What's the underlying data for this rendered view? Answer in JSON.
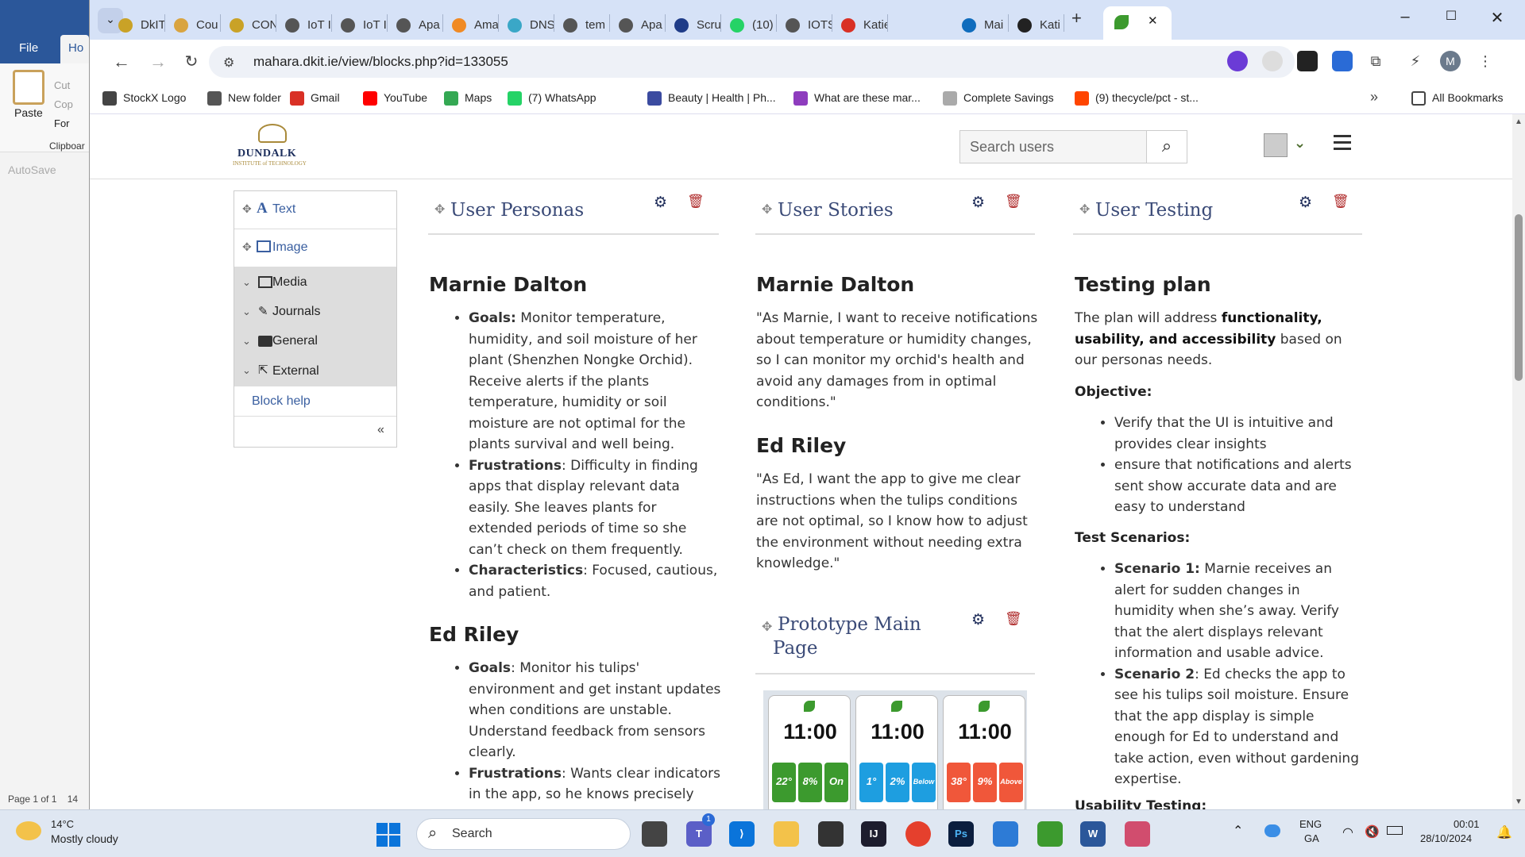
{
  "word": {
    "file_tab": "File",
    "home_tab": "Ho",
    "paste_label": "Paste",
    "cut_label": "Cut",
    "copy_label": "Cop",
    "format_label": "For",
    "clipboard_label": "Clipboar",
    "autosave_label": "AutoSave",
    "status_page": "Page 1 of 1",
    "status_words": "14"
  },
  "browser": {
    "tabs": [
      {
        "label": "DkIT",
        "color": "#c9a227"
      },
      {
        "label": "Cou",
        "color": "#d9a440"
      },
      {
        "label": "CON",
        "color": "#c9a227"
      },
      {
        "label": "IoT I",
        "color": "#555"
      },
      {
        "label": "IoT I",
        "color": "#555"
      },
      {
        "label": "Apa",
        "color": "#555"
      },
      {
        "label": "Ama",
        "color": "#f08a24"
      },
      {
        "label": "DNS",
        "color": "#3aa7c7"
      },
      {
        "label": "tem",
        "color": "#555"
      },
      {
        "label": "Apa",
        "color": "#555"
      },
      {
        "label": "Scru",
        "color": "#1f3c88"
      },
      {
        "label": "(10)",
        "color": "#25d366"
      },
      {
        "label": "IOTS",
        "color": "#555"
      },
      {
        "label": "Katie",
        "color": "#d93025"
      },
      {
        "label": "",
        "color": "#3c9a2e"
      },
      {
        "label": "Mai",
        "color": "#0f6cbd"
      },
      {
        "label": "Kati",
        "color": "#222"
      }
    ],
    "close_tab_glyph": "✕",
    "new_tab_glyph": "+",
    "url": "mahara.dkit.ie/view/blocks.php?id=133055",
    "profile_initial": "M",
    "bookmarks": [
      {
        "label": "StockX Logo",
        "color": "#444"
      },
      {
        "label": "New folder",
        "color": "#555"
      },
      {
        "label": "Gmail",
        "color": "#d93025"
      },
      {
        "label": "YouTube",
        "color": "#ff0000"
      },
      {
        "label": "Maps",
        "color": "#34a853"
      },
      {
        "label": "(7) WhatsApp",
        "color": "#25d366"
      },
      {
        "label": "Beauty | Health | Ph...",
        "color": "#3b4ba0"
      },
      {
        "label": "What are these mar...",
        "color": "#8e3cbe"
      },
      {
        "label": "Complete Savings",
        "color": "#aaa"
      },
      {
        "label": "(9) thecycle/pct - st...",
        "color": "#ff4500"
      }
    ],
    "more_bookmarks": "»",
    "all_bookmarks": "All Bookmarks"
  },
  "site": {
    "logo_text": "DUNDALK",
    "logo_sub": "INSTITUTE of TECHNOLOGY",
    "search_placeholder": "Search users"
  },
  "block_panel": {
    "items": [
      {
        "label": "Text",
        "type": "block"
      },
      {
        "label": "Image",
        "type": "block"
      },
      {
        "label": "Media",
        "type": "category"
      },
      {
        "label": "Journals",
        "type": "category"
      },
      {
        "label": "General",
        "type": "category"
      },
      {
        "label": "External",
        "type": "category"
      }
    ],
    "help": "Block help",
    "collapse": "«"
  },
  "columns": {
    "personas": {
      "title": "User Personas",
      "p1_name": "Marnie Dalton",
      "p1_goals_label": "Goals:",
      "p1_goals": "Monitor temperature, humidity, and soil moisture of her plant (Shenzhen Nongke Orchid). Receive alerts if the plants temperature, humidity or soil moisture are not optimal for the plants survival and well being.",
      "p1_frust_label": "Frustrations",
      "p1_frust": ": Difficulty in finding apps that display relevant data easily. She leaves plants for extended periods of time so she can’t check on them frequently.",
      "p1_char_label": "Characteristics",
      "p1_char": ": Focused, cautious, and patient.",
      "p2_name": "Ed Riley",
      "p2_goals_label": "Goals",
      "p2_goals": ": Monitor his tulips' environment and get instant updates when conditions are unstable. Understand feedback from sensors clearly.",
      "p2_frust_label": "Frustrations",
      "p2_frust": ": Wants clear indicators in the app, so he knows precisely what’s wrong. Needs an easy way to"
    },
    "stories": {
      "title": "User Stories",
      "s1_name": "Marnie Dalton",
      "s1_text": "\"As Marnie, I want to receive notifications about temperature or humidity changes, so I can monitor my orchid's health and avoid any damages from in optimal conditions.\"",
      "s2_name": "Ed Riley",
      "s2_text": "\"As Ed, I want the app to give me clear instructions when the tulips conditions are not optimal, so I know how to adjust the environment without needing extra knowledge.\""
    },
    "prototype": {
      "title_line1": "Prototype Main",
      "title_line2": "Page",
      "phones": [
        {
          "time": "11:00",
          "tiles": [
            "22°",
            "8%",
            "On"
          ],
          "color": "#3c9a2e"
        },
        {
          "time": "11:00",
          "tiles": [
            "1°",
            "2%",
            "Below"
          ],
          "color": "#1e9ee0"
        },
        {
          "time": "11:00",
          "tiles": [
            "38°",
            "9%",
            "Above"
          ],
          "color": "#f0573a"
        }
      ]
    },
    "testing": {
      "title": "User Testing",
      "heading": "Testing plan",
      "intro_pre": "The plan will address ",
      "intro_bold": "functionality, usability, and accessibility",
      "intro_post": " based on our personas needs.",
      "objective_label": "Objective:",
      "objectives": [
        "Verify that the UI is intuitive and provides clear insights",
        "ensure that notifications and alerts sent show accurate data and are easy to understand"
      ],
      "scenarios_label": "Test Scenarios:",
      "sc1_label": "Scenario 1:",
      "sc1_text": " Marnie receives an alert for sudden changes in humidity when she’s away. Verify that the alert displays relevant information and usable advice.",
      "sc2_label": "Scenario 2",
      "sc2_text": ": Ed checks the app to see his tulips soil moisture. Ensure that the app display is simple enough for Ed to understand and take action, even without gardening expertise.",
      "usability_label": "Usability Testing:"
    }
  },
  "taskbar": {
    "weather_temp": "14°C",
    "weather_desc": "Mostly cloudy",
    "search_label": "Search",
    "teams_badge": "1",
    "lang_1": "ENG",
    "lang_2": "GA",
    "time": "00:01",
    "date": "28/10/2024"
  }
}
